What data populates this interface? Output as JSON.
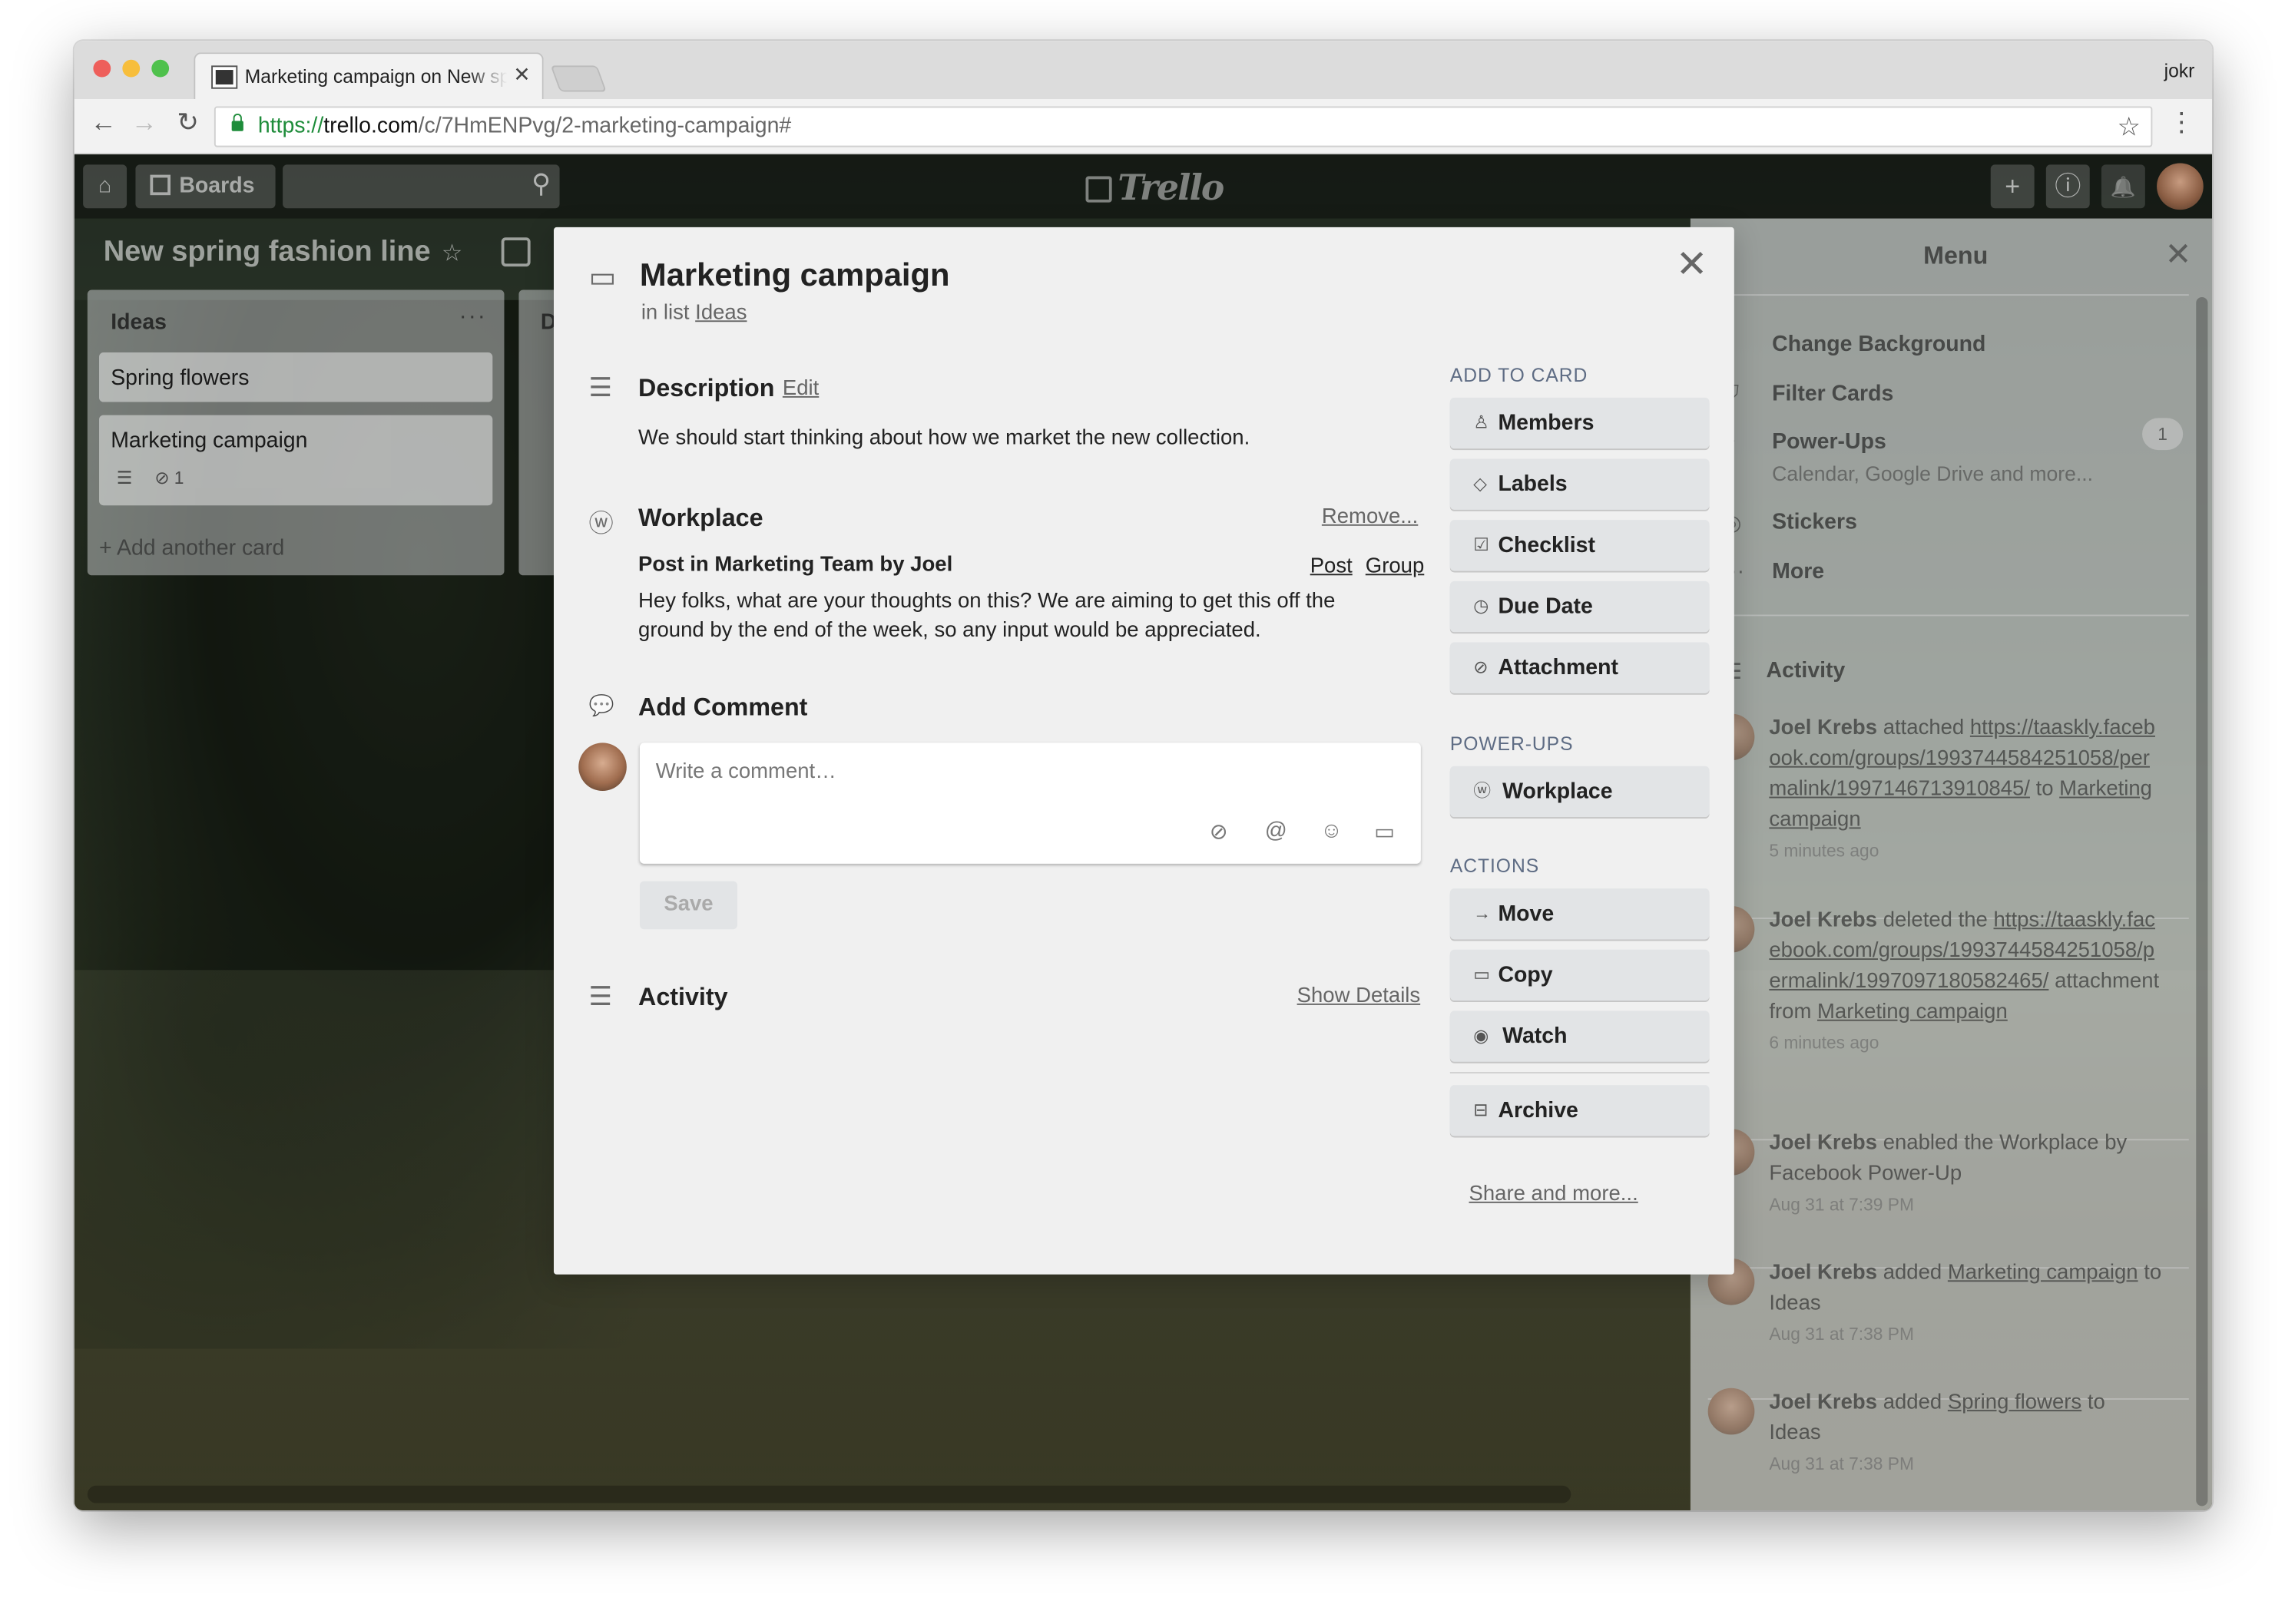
{
  "browser": {
    "tab_title": "Marketing campaign on New spring fashion line",
    "tab_close": "✕",
    "profile_name": "jokr",
    "url": {
      "scheme": "https://",
      "host": "trello.com",
      "path": "/c/7HmENPvg/2-marketing-campaign#"
    },
    "back_icon": "←",
    "forward_icon": "→",
    "reload_icon": "↻",
    "star_icon": "☆",
    "menu_icon": "⋮",
    "traffic_lights": {
      "close": "#ee5f5b",
      "minimize": "#f7be3c",
      "zoom": "#4fc14c"
    }
  },
  "header": {
    "home_icon": "⌂",
    "boards_label": "Boards",
    "search_icon": "⚲",
    "logo_text": "Trello",
    "add_icon": "+",
    "info_icon": "ⓘ",
    "bell_icon": "🔔"
  },
  "board": {
    "title": "New spring fashion line",
    "star_icon": "☆",
    "list": {
      "title": "Ideas",
      "menu": "···",
      "cards": [
        {
          "title": "Spring flowers"
        },
        {
          "title": "Marketing campaign",
          "desc_icon": "☰",
          "attach_icon": "⊘",
          "attach_count": "1"
        }
      ],
      "add_card": "+ Add another card"
    },
    "list2_initial": "D"
  },
  "menu": {
    "title": "Menu",
    "close": "✕",
    "items": [
      {
        "label": "Change Background",
        "icon": "▪"
      },
      {
        "label": "Filter Cards",
        "icon": "⛉"
      },
      {
        "label": "Power-Ups",
        "icon": "⌖",
        "sub": "Calendar, Google Drive and more...",
        "badge": "1"
      },
      {
        "label": "Stickers",
        "icon": "◎"
      },
      {
        "label": "More",
        "icon": "···"
      }
    ],
    "activity_title": "Activity",
    "activity_icon": "☰",
    "activity": [
      {
        "user": "Joel Krebs",
        "action": " attached ",
        "link": "https://taaskly.facebook.com/groups/1993744584251058/permalink/1997146713910845/",
        "mid": " to ",
        "target": "Marketing campaign",
        "tail": "",
        "time": "5 minutes ago"
      },
      {
        "user": "Joel Krebs",
        "action": " deleted the ",
        "link": "https://taaskly.facebook.com/groups/1993744584251058/permalink/1997097180582465/",
        "mid": " attachment from ",
        "target": "Marketing campaign",
        "tail": "",
        "time": "6 minutes ago"
      },
      {
        "user": "Joel Krebs",
        "action": " enabled the Workplace by Facebook Power-Up",
        "link": "",
        "mid": "",
        "target": "",
        "tail": "",
        "time": "Aug 31 at 7:39 PM"
      },
      {
        "user": "Joel Krebs",
        "action": " added ",
        "link": "",
        "mid": "",
        "target": "Marketing campaign",
        "tail": " to Ideas",
        "time": "Aug 31 at 7:38 PM"
      },
      {
        "user": "Joel Krebs",
        "action": " added ",
        "link": "",
        "mid": "",
        "target": "Spring flowers",
        "tail": " to Ideas",
        "time": "Aug 31 at 7:38 PM"
      }
    ]
  },
  "modal": {
    "title": "Marketing campaign",
    "in_list_prefix": "in list ",
    "in_list_name": "Ideas",
    "close": "✕",
    "card_icon": "▭",
    "description": {
      "title": "Description",
      "edit": "Edit",
      "text": "We should start thinking about how we market the new collection.",
      "icon": "☰"
    },
    "workplace": {
      "title": "Workplace",
      "remove": "Remove...",
      "icon": "ⓦ",
      "post_title": "Post in Marketing Team by Joel",
      "post_link": "Post",
      "group_link": "Group",
      "text": "Hey folks, what are your thoughts on this? We are aiming to get this off the ground by the end of the week, so any input would be appreciated."
    },
    "comment": {
      "title": "Add Comment",
      "icon": "💬",
      "placeholder": "Write a comment…",
      "icons": {
        "attach": "⊘",
        "mention": "@",
        "emoji": "☺",
        "card": "▭"
      },
      "save": "Save"
    },
    "activity": {
      "title": "Activity",
      "show_details": "Show Details",
      "icon": "☰"
    },
    "add_to_card": {
      "heading": "ADD TO CARD",
      "buttons": [
        {
          "label": "Members",
          "icon": "♙"
        },
        {
          "label": "Labels",
          "icon": "◇"
        },
        {
          "label": "Checklist",
          "icon": "☑"
        },
        {
          "label": "Due Date",
          "icon": "◷"
        },
        {
          "label": "Attachment",
          "icon": "⊘"
        }
      ]
    },
    "power_ups": {
      "heading": "POWER-UPS",
      "buttons": [
        {
          "label": "Workplace",
          "icon": "ⓦ"
        }
      ]
    },
    "actions": {
      "heading": "ACTIONS",
      "buttons": [
        {
          "label": "Move",
          "icon": "→"
        },
        {
          "label": "Copy",
          "icon": "▭"
        },
        {
          "label": "Watch",
          "icon": "◉"
        },
        {
          "label": "Archive",
          "icon": "⊟"
        }
      ]
    },
    "share": "Share and more..."
  }
}
